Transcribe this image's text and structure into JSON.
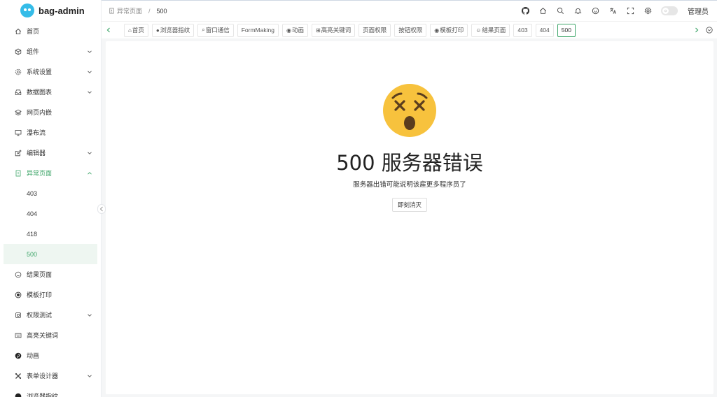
{
  "app": {
    "name": "bag-admin"
  },
  "sidebar": {
    "items": [
      {
        "label": "首页",
        "icon": "home-icon",
        "expandable": false
      },
      {
        "label": "组件",
        "icon": "cube-icon",
        "expandable": true
      },
      {
        "label": "系统设置",
        "icon": "gear-icon",
        "expandable": true
      },
      {
        "label": "数据图表",
        "icon": "inbox-icon",
        "expandable": true
      },
      {
        "label": "网页内嵌",
        "icon": "layers-icon",
        "expandable": false
      },
      {
        "label": "瀑布流",
        "icon": "monitor-icon",
        "expandable": false
      },
      {
        "label": "编辑器",
        "icon": "edit-icon",
        "expandable": true
      },
      {
        "label": "异常页面",
        "icon": "warning-page-icon",
        "expandable": true,
        "expanded": true
      },
      {
        "label": "403",
        "sub": true
      },
      {
        "label": "404",
        "sub": true
      },
      {
        "label": "418",
        "sub": true
      },
      {
        "label": "500",
        "sub": true,
        "selected": true
      },
      {
        "label": "结果页面",
        "icon": "smile-icon",
        "expandable": false
      },
      {
        "label": "模板打印",
        "icon": "print-record-icon",
        "expandable": false
      },
      {
        "label": "权限测试",
        "icon": "lock-icon",
        "expandable": true
      },
      {
        "label": "高亮关键词",
        "icon": "keyboard-icon",
        "expandable": false
      },
      {
        "label": "动画",
        "icon": "pinterest-icon",
        "expandable": false
      },
      {
        "label": "表单设计器",
        "icon": "design-icon",
        "expandable": true
      },
      {
        "label": "浏览器指纹",
        "icon": "fingerprint-icon",
        "expandable": false
      }
    ]
  },
  "header": {
    "breadcrumb": {
      "parent": "异常页面",
      "current": "500"
    },
    "username": "管理员",
    "theme_toggle_symbol": "☼"
  },
  "tabs": [
    {
      "label": "首页",
      "icon": "⌂"
    },
    {
      "label": "浏览器指纹",
      "icon": "●"
    },
    {
      "label": "窗口通信",
      "icon": "⌕"
    },
    {
      "label": "FormMaking",
      "icon": ""
    },
    {
      "label": "动画",
      "icon": "◉"
    },
    {
      "label": "高亮关键词",
      "icon": "⊞"
    },
    {
      "label": "页面权限",
      "icon": ""
    },
    {
      "label": "按钮权限",
      "icon": ""
    },
    {
      "label": "模板打印",
      "icon": "◉"
    },
    {
      "label": "结果页面",
      "icon": "☺"
    },
    {
      "label": "403",
      "icon": ""
    },
    {
      "label": "404",
      "icon": ""
    },
    {
      "label": "500",
      "icon": "",
      "active": true
    }
  ],
  "content": {
    "title": "500 服务器错误",
    "subtitle": "服务器出错可能说明该雇更多程序员了",
    "button_label": "即刻消灭",
    "emoji_color": "#f7c23d"
  },
  "colors": {
    "accent": "#3fa66a"
  }
}
